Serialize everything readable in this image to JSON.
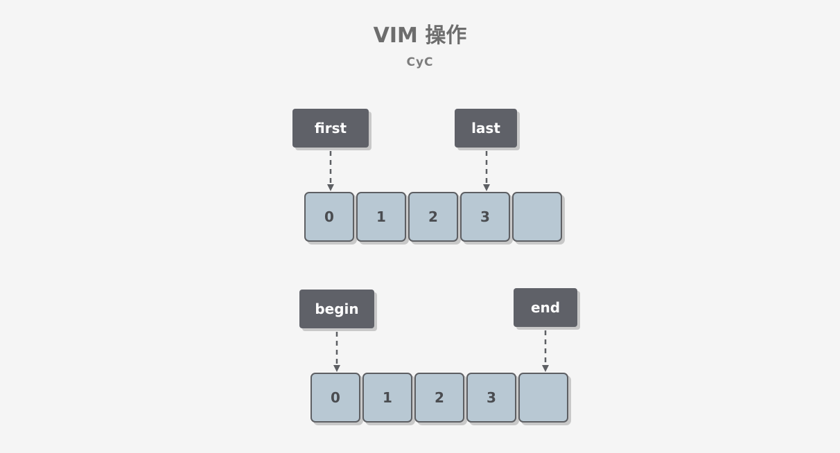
{
  "title": "VIM 操作",
  "subtitle": "CyC",
  "diagram1": {
    "pointers": [
      {
        "label": "first",
        "target_index": 0
      },
      {
        "label": "last",
        "target_index": 3
      }
    ],
    "cells": [
      "0",
      "1",
      "2",
      "3",
      ""
    ]
  },
  "diagram2": {
    "pointers": [
      {
        "label": "begin",
        "target_index": 0
      },
      {
        "label": "end",
        "target_index": 4
      }
    ],
    "cells": [
      "0",
      "1",
      "2",
      "3",
      ""
    ]
  },
  "colors": {
    "background": "#f5f5f5",
    "label_fill": "#5f6168",
    "cell_fill": "#b8c8d3",
    "cell_border": "#5d5f63",
    "arrow": "#5d5f63"
  }
}
